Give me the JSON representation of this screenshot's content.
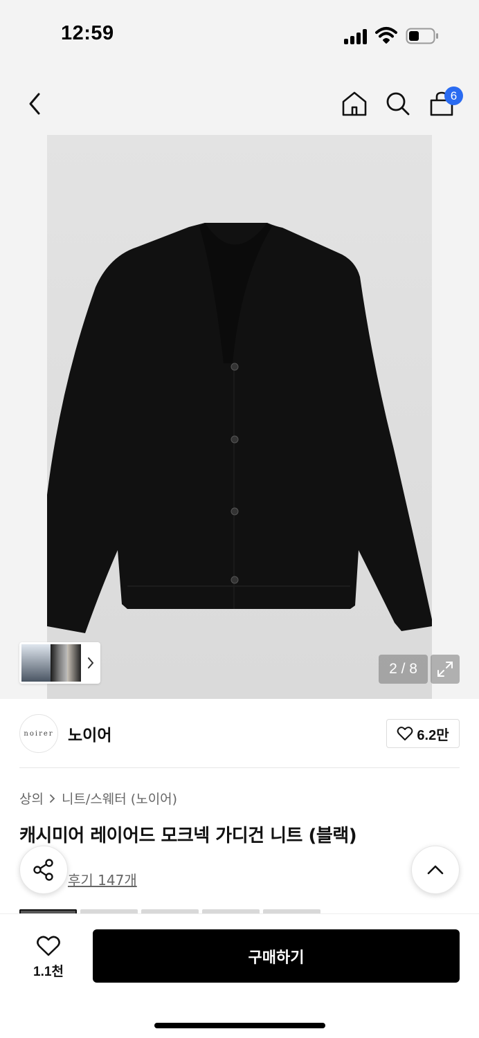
{
  "status_bar": {
    "time": "12:59"
  },
  "nav": {
    "cart_count": "6",
    "icons": [
      "back-arrow-icon",
      "home-icon",
      "search-icon",
      "shopping-bag-icon"
    ]
  },
  "gallery": {
    "page_counter": "2 / 8",
    "image_subject": "black-cardigan",
    "background_color": "#e0e0e0"
  },
  "brand": {
    "logo_text": "noirer",
    "name": "노이어",
    "likes": "6.2만"
  },
  "breadcrumb": {
    "category": "상의",
    "subcategory": "니트/스웨터 (노이어)"
  },
  "product": {
    "title": "캐시미어 레이어드 모크넥 가디건 니트 (블랙)",
    "review_link": "후기 147개"
  },
  "bottom_bar": {
    "wish_count": "1.1천",
    "buy_label": "구매하기"
  },
  "colors": {
    "badge": "#2a6bf1",
    "primary_button": "#000000"
  }
}
